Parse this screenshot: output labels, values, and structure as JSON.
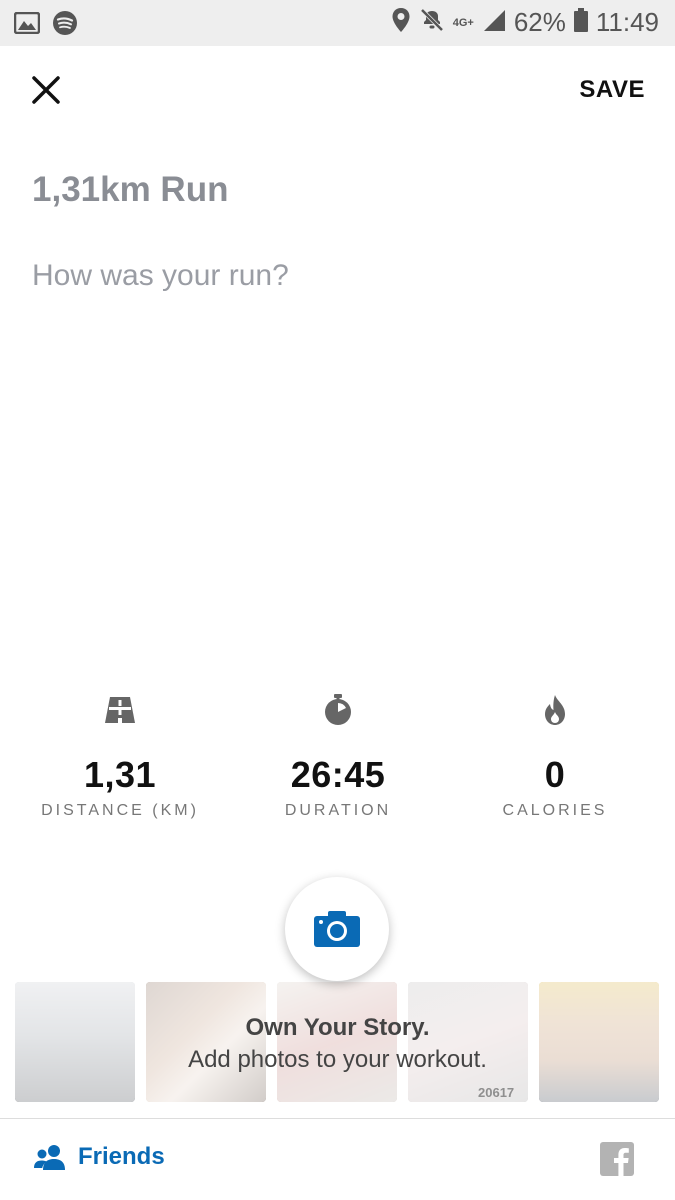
{
  "status_bar": {
    "network": "4G+",
    "battery": "62%",
    "time": "11:49"
  },
  "header": {
    "save_label": "SAVE"
  },
  "workout": {
    "title": "1,31km Run",
    "notes_placeholder": "How was your run?"
  },
  "stats": [
    {
      "icon": "road-icon",
      "value": "1,31",
      "label": "DISTANCE (KM)"
    },
    {
      "icon": "stopwatch-icon",
      "value": "26:45",
      "label": "DURATION"
    },
    {
      "icon": "flame-icon",
      "value": "0",
      "label": "CALORIES"
    }
  ],
  "story": {
    "title": "Own Your Story.",
    "subtitle": "Add photos to your workout.",
    "thumb_caption": "20617"
  },
  "bottom_bar": {
    "friends_label": "Friends"
  },
  "colors": {
    "accent": "#0a6ab5",
    "title_gray": "#8a8d94",
    "status_bar_bg": "#eeeeee"
  }
}
